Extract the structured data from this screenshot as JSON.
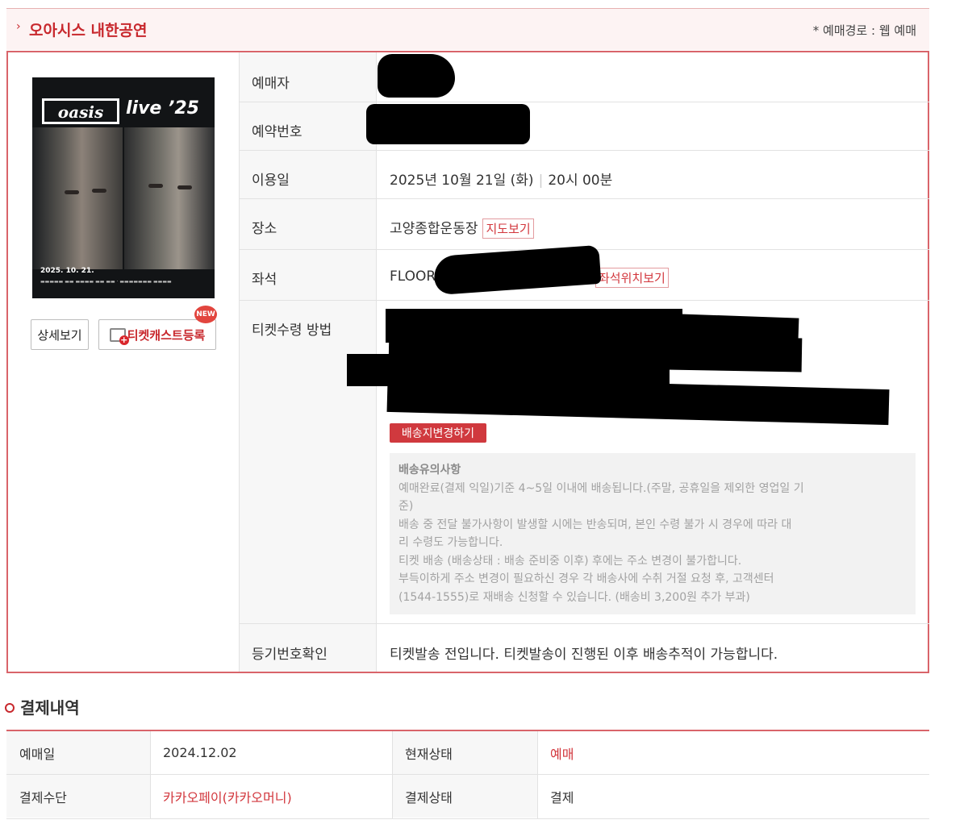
{
  "header": {
    "arrow": "›",
    "title": "오아시스 내한공연",
    "route": "* 예매경로 : 웹 예매"
  },
  "poster": {
    "band": "oasis",
    "live": "live ’25",
    "date": "2025. 10. 21."
  },
  "buttons": {
    "detail": "상세보기",
    "ticketcast": "티켓캐스트등록",
    "new_badge": "NEW",
    "change_address": "배송지변경하기"
  },
  "info": {
    "booker_label": "예매자",
    "reservation_label": "예약번호",
    "date_label": "이용일",
    "date_value": "2025년 10월 21일 (화)",
    "time_value": "20시 00분",
    "venue_label": "장소",
    "venue_value": "고양종합운동장",
    "map_link": "지도보기",
    "seat_label": "좌석",
    "seat_value": "FLOOR",
    "seat_link": "좌석위치보기",
    "receive_label": "티켓수령 방법",
    "tracking_label": "등기번호확인",
    "tracking_value": "티켓발송 전입니다. 티켓발송이 진행된 이후 배송추적이 가능합니다."
  },
  "notice": {
    "title": "배송유의사항",
    "lines": [
      "예매완료(결제 익일)기준 4~5일 이내에 배송됩니다.(주말, 공휴일을 제외한 영업일 기",
      "준)",
      "배송 중 전달 불가사항이 발생할 시에는 반송되며, 본인 수령 불가 시 경우에 따라 대",
      "리 수령도 가능합니다.",
      "티켓 배송 (배송상태 : 배송 준비중 이후) 후에는 주소 변경이 불가합니다.",
      "부득이하게 주소 변경이 필요하신 경우 각 배송사에 수취 거절 요청 후, 고객센터",
      "(1544-1555)로 재배송 신청할 수 있습니다. (배송비 3,200원 추가 부과)"
    ]
  },
  "payment": {
    "title": "결제내역",
    "booking_date_label": "예매일",
    "booking_date_value": "2024.12.02",
    "status_label": "현재상태",
    "status_value": "예매",
    "method_label": "결제수단",
    "method_value": "카카오페이(카카오머니)",
    "pay_status_label": "결제상태",
    "pay_status_value": "결제"
  },
  "colors": {
    "accent": "#c8282d",
    "border": "#d9646a"
  }
}
